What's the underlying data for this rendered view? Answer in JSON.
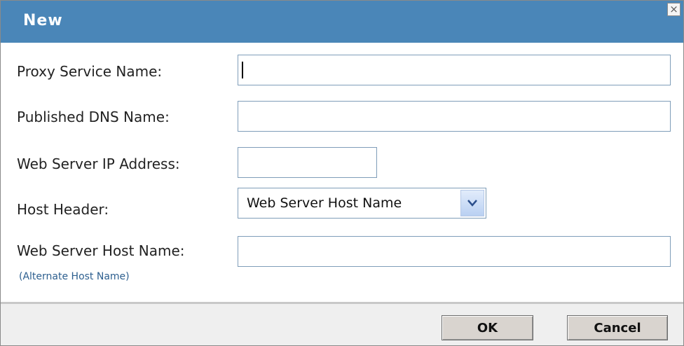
{
  "dialog": {
    "title": "New",
    "close_glyph": "×"
  },
  "form": {
    "proxy_service_name": {
      "label": "Proxy Service Name:",
      "value": ""
    },
    "published_dns_name": {
      "label": "Published DNS Name:",
      "value": ""
    },
    "web_server_ip": {
      "label": "Web Server IP Address:",
      "value": ""
    },
    "host_header": {
      "label": "Host Header:",
      "selected": "Web Server Host Name"
    },
    "web_server_host_name": {
      "label": "Web Server Host Name:",
      "value": "",
      "hint": "(Alternate Host Name)"
    }
  },
  "footer": {
    "ok_label": "OK",
    "cancel_label": "Cancel"
  },
  "icons": {
    "close": "close-icon",
    "dropdown": "chevron-down-icon"
  },
  "colors": {
    "titlebar": "#4a86b8",
    "field_border": "#7f9db9",
    "hint_link": "#2d5f8f"
  }
}
